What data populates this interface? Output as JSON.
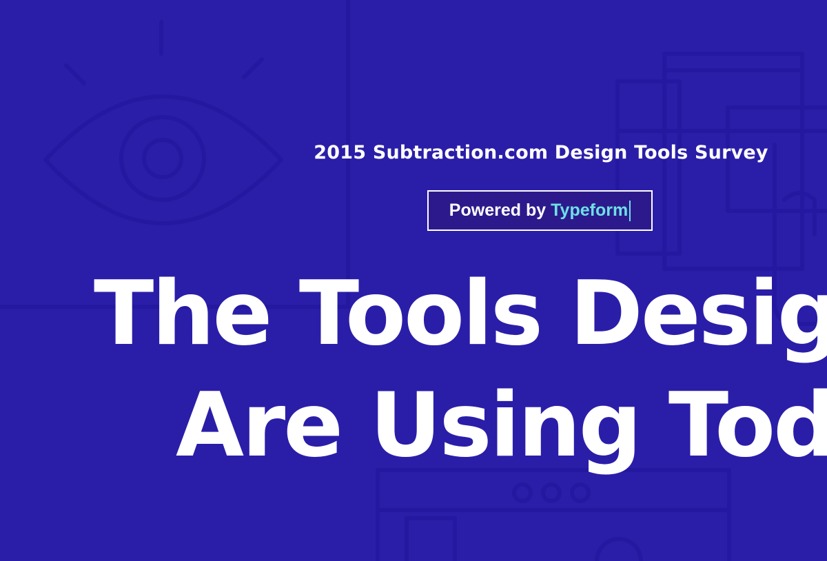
{
  "survey": {
    "title": "2015 Subtraction.com Design Tools Survey"
  },
  "badge": {
    "prefix": "Powered by",
    "brand": "Typeform"
  },
  "headline": {
    "line_1": "The Tools Designers",
    "line_2": "Are Using Today"
  },
  "colors": {
    "background": "#2a1ea8",
    "line_art": "#2418a0",
    "text": "#ffffff",
    "badge_background": "#2c1a8c",
    "brand_accent": "#6ee0e6"
  },
  "icons": {
    "eye": "eye-icon",
    "clipboard": "clipboard-icon",
    "browser": "browser-window-icon"
  }
}
